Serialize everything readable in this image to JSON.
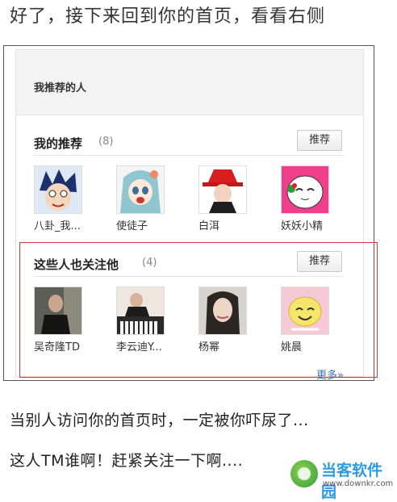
{
  "caption_top": "好了，接下来回到你的首页，看看右侧",
  "panel": {
    "title": "我推荐的人",
    "sections": [
      {
        "title": "我的推荐",
        "count": "(8)",
        "button": "推荐",
        "people": [
          {
            "name": "八卦_我..."
          },
          {
            "name": "使徒子"
          },
          {
            "name": "白洱"
          },
          {
            "name": "妖妖小精"
          }
        ]
      },
      {
        "title": "这些人也关注他",
        "count": "(4)",
        "button": "推荐",
        "people": [
          {
            "name": "吴奇隆TD"
          },
          {
            "name": "李云迪Y..."
          },
          {
            "name": "杨幂"
          },
          {
            "name": "姚晨"
          }
        ]
      }
    ],
    "more_link": "更多»",
    "highlight_color": "#e03030"
  },
  "caption_bottom": [
    "当别人访问你的首页时，一定被你吓尿了...",
    "这人TM谁啊！赶紧关注一下啊...."
  ],
  "watermark": {
    "text": "当客软件园",
    "url": "www.downkr.com"
  }
}
